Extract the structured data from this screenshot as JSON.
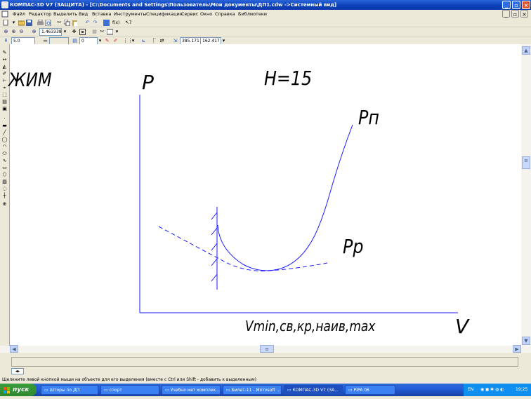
{
  "window": {
    "title": "КОМПАС-3D V7 (ЗАЩИТА) - [C:\\Documents and Settings\\Пользователь\\Мои документы\\ДП1.cdw ->Системный вид]"
  },
  "menu": [
    "Файл",
    "Редактор",
    "Выделить",
    "Вид",
    "Вставка",
    "Инструменты",
    "Спецификация",
    "Сервис",
    "Окно",
    "Справка",
    "Библиотеки"
  ],
  "toolbar": {
    "zoom_value": "1.463338",
    "line_scale": "5.0",
    "layer": "0",
    "coord_x": "385.171",
    "coord_y": "162.417"
  },
  "drawing": {
    "label_mode": "ЖИМ",
    "label_p": "P",
    "label_h": "H=15",
    "label_pn": "Pп",
    "label_pp": "Pp",
    "label_x_axis": "Vmin,св,кр,наив,max",
    "label_v": "V"
  },
  "statusbar": {
    "hint": "Щелкните левой кнопкой мыши на объекте для его выделения (вместе с Ctrl или Shift - добавить к выделенным)"
  },
  "taskbar": {
    "start_label": "пуск",
    "tasks": [
      "Шторы по ДП",
      "спорт",
      "Учебно мет комплек...",
      "Билет-11 - Microsoft ...",
      "КОМПАС-3D V7 (ЗА...",
      "PIPA 06"
    ],
    "language": "EN",
    "clock": "19:25"
  },
  "colors": {
    "title_bar": "#0a3fb8",
    "drawing_line": "#1a1aff",
    "taskbar": "#245edb",
    "start_button": "#2f8a2f"
  }
}
